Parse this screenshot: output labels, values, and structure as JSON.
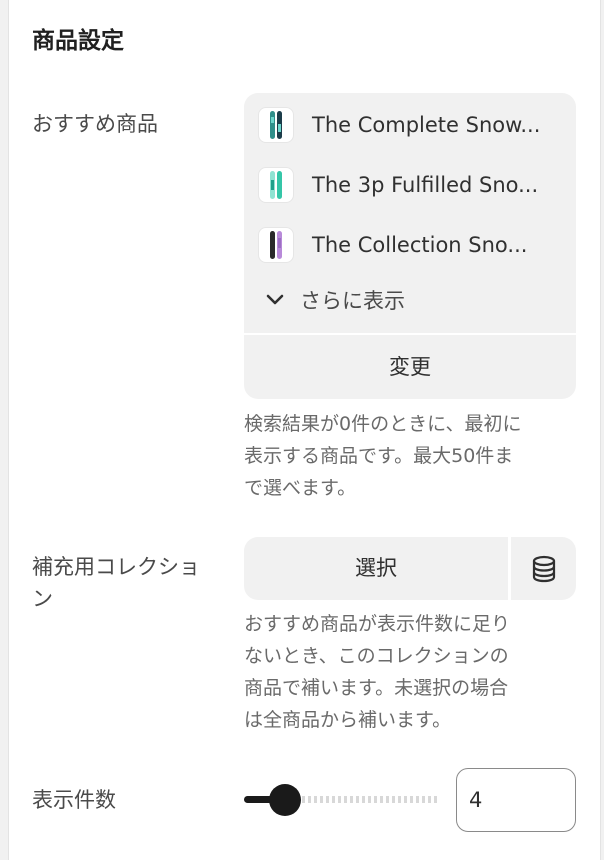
{
  "section_title": "商品設定",
  "recommended": {
    "label": "おすすめ商品",
    "products": [
      {
        "title": "The Complete Snow...",
        "thumb_colors": [
          "#2f8f8a",
          "#6dd6cc",
          "#1b3d4a"
        ]
      },
      {
        "title": "The 3p Fulfilled Sno...",
        "thumb_colors": [
          "#35c6a8",
          "#8fe3d2",
          "#1fa08a"
        ]
      },
      {
        "title": "The Collection Sno...",
        "thumb_colors": [
          "#2a2a2a",
          "#b88ad9",
          "#9d6fc4"
        ]
      }
    ],
    "show_more_label": "さらに表示",
    "change_label": "変更",
    "help_lines": [
      "検索結果が0件のときに、最初に",
      "表示する商品です。最大50件ま",
      "で選べます。"
    ]
  },
  "fallback": {
    "label_lines": [
      "補充用コレクショ",
      "ン"
    ],
    "select_label": "選択",
    "help_lines": [
      "おすすめ商品が表示件数に足り",
      "ないとき、このコレクションの",
      "商品で補います。未選択の場合",
      "は全商品から補います。"
    ]
  },
  "display_count": {
    "label": "表示件数",
    "value": "4",
    "slider_fraction": 0.15
  },
  "colors": {
    "accent": "#1a1a1a",
    "surface": "#f1f1f1"
  }
}
